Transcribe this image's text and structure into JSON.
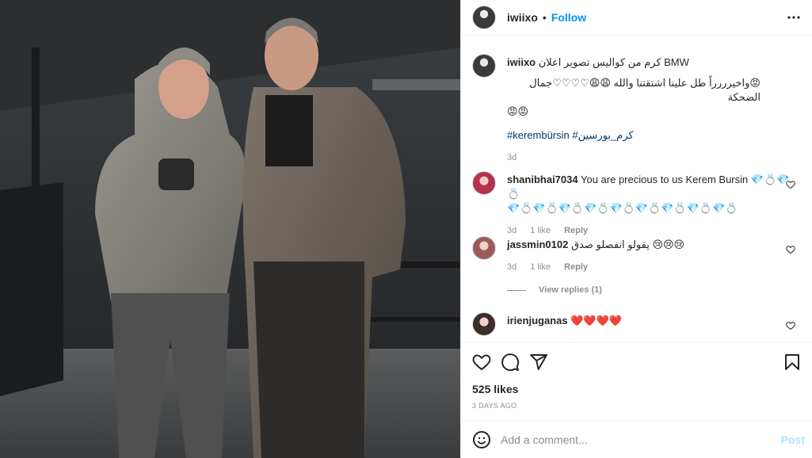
{
  "header": {
    "username": "iwiixo",
    "separator": "•",
    "follow_label": "Follow"
  },
  "caption": {
    "username": "iwiixo",
    "text_line1": "كرم من كواليس تصوير اعلان BMW",
    "text_line2": "😡واخيرررراً طل علينا اشتقتنا والله 😩😩♡♡♡♡جمال الضحكة",
    "text_line3": "😡😡",
    "hashtags": "#kerembürsin #كرم_بورسين",
    "time": "3d"
  },
  "comments": [
    {
      "username": "shanibhai7034",
      "text_line1": "You are precious to us Kerem Bursin 💎💍💎💍",
      "text_line2": "💎💍💎💍💎💍💎💍💎💍💎💍💎💍💎💍💎💍",
      "time": "3d",
      "likes": "1 like",
      "reply_label": "Reply"
    },
    {
      "username": "jassmin0102",
      "text": "يقولو انفصلو صدق 😢😢😢",
      "time": "3d",
      "likes": "1 like",
      "reply_label": "Reply",
      "view_replies": "View replies (1)"
    },
    {
      "username": "irienjuganas",
      "text": "❤️❤️❤️❤️"
    }
  ],
  "actions": {
    "likes": "525 likes",
    "posted": "3 DAYS AGO"
  },
  "add_comment": {
    "placeholder": "Add a comment...",
    "post_label": "Post"
  }
}
